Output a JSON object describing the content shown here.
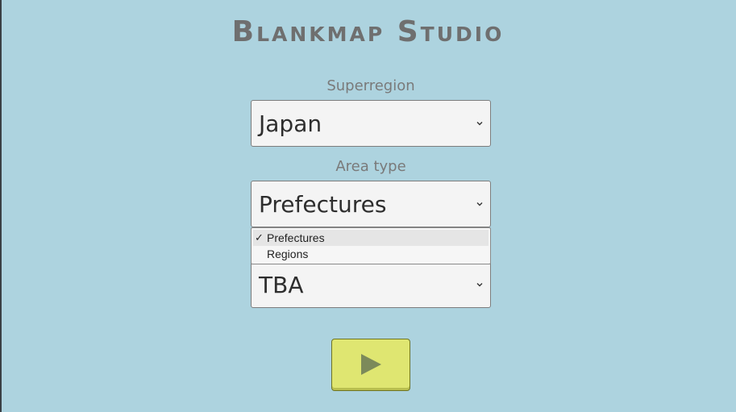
{
  "app": {
    "title": "Blankmap Studio"
  },
  "superregion": {
    "label": "Superregion",
    "value": "Japan"
  },
  "area_type": {
    "label": "Area type",
    "value": "Prefectures",
    "options": [
      {
        "label": "Prefectures",
        "selected": true
      },
      {
        "label": "Regions",
        "selected": false
      }
    ]
  },
  "third_select": {
    "value": "TBA"
  },
  "play": {
    "icon": "play-icon"
  },
  "colors": {
    "background": "#add3df",
    "play_button": "#dfe671"
  }
}
